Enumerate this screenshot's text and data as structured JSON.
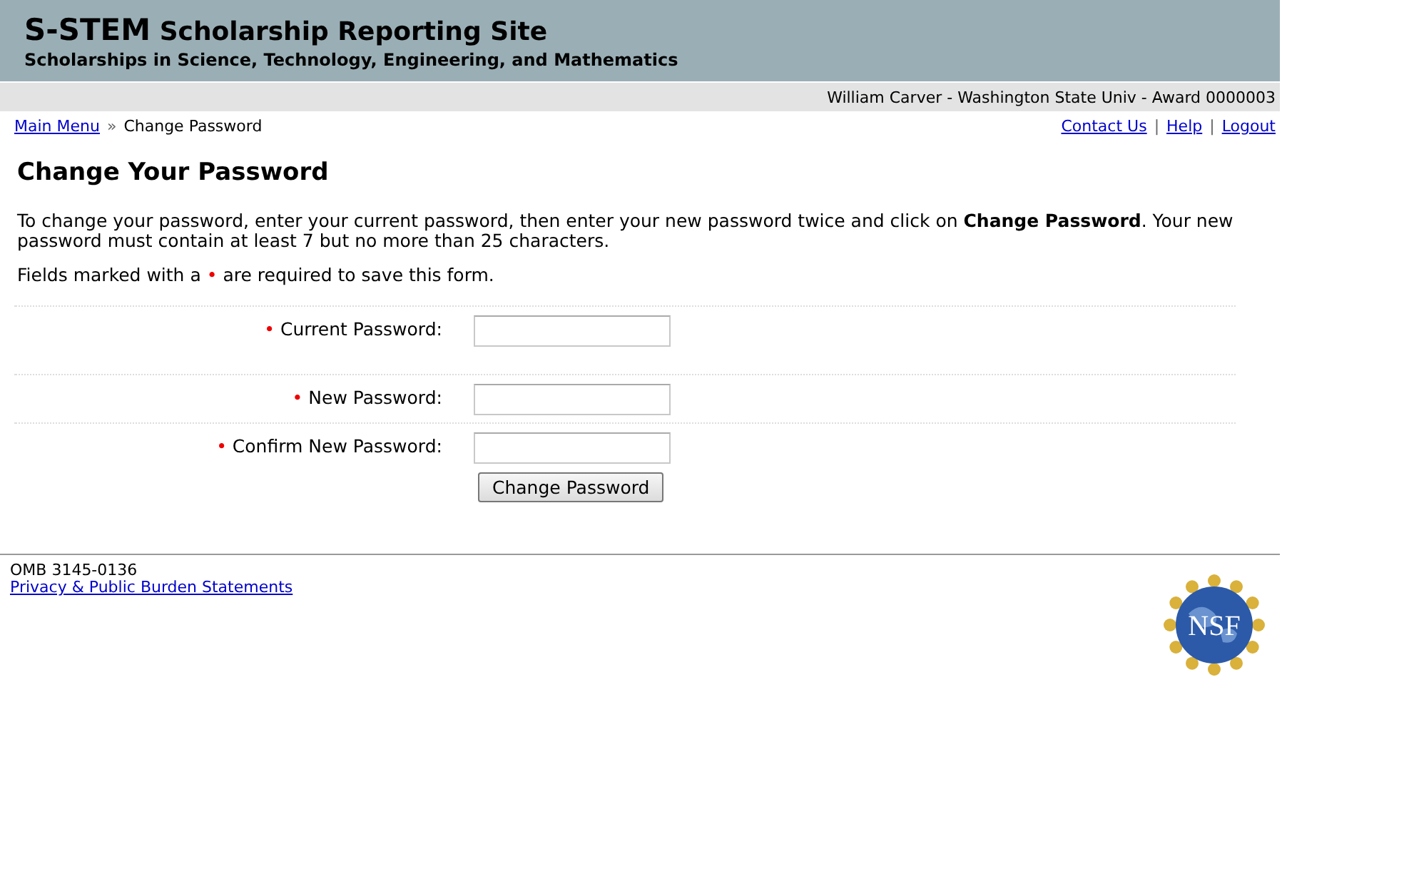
{
  "header": {
    "title": "S-STEM",
    "subtitle_inline": "Scholarship Reporting Site",
    "tagline": "Scholarships in Science, Technology, Engineering, and Mathematics"
  },
  "user_bar": "William Carver - Washington State Univ - Award 0000003",
  "breadcrumb": [
    {
      "label": "Main Menu",
      "kind": "link"
    },
    {
      "label": "»",
      "kind": "separator"
    },
    {
      "label": "Change Password",
      "kind": "text"
    }
  ],
  "top_links": [
    {
      "label": "Contact Us"
    },
    {
      "label": "Help"
    },
    {
      "label": "Logout"
    }
  ],
  "link_separator": "|",
  "heading": "Change Your Password",
  "intro": "To change your password, enter your current password, then enter your new password twice and click on **Change Password**. Your new password must contain at least 7 but no more than 25 characters.",
  "required_note": {
    "before": "Fields marked with a",
    "mark": "•",
    "after": "are required to save this form."
  },
  "fields": [
    {
      "label": "Current Password:",
      "required": true,
      "spacious": true
    },
    {
      "label": "New Password:",
      "required": true,
      "spacious": false
    },
    {
      "label": "Confirm New Password:",
      "required": true,
      "spacious": false
    }
  ],
  "submit_button": "Change Password",
  "footer": {
    "omb": "OMB 3145-0136",
    "privacy_link": "Privacy & Public Burden Statements",
    "logo_text": "NSF"
  }
}
